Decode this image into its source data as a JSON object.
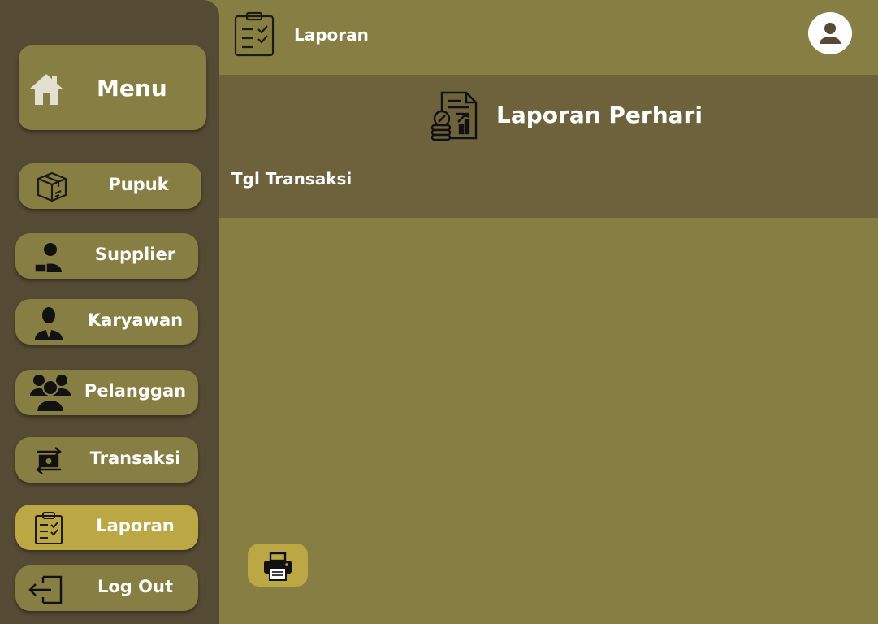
{
  "sidebar": {
    "menu_label": "Menu",
    "items": [
      {
        "label": "Pupuk",
        "icon": "box-icon"
      },
      {
        "label": "Supplier",
        "icon": "supplier-icon"
      },
      {
        "label": "Karyawan",
        "icon": "employee-icon"
      },
      {
        "label": "Pelanggan",
        "icon": "customers-icon"
      },
      {
        "label": "Transaksi",
        "icon": "transaction-icon"
      },
      {
        "label": "Laporan",
        "icon": "clipboard-icon",
        "active": true
      },
      {
        "label": "Log Out",
        "icon": "logout-icon"
      }
    ]
  },
  "header": {
    "title": "Laporan"
  },
  "report": {
    "title": "Laporan Perhari",
    "date_label": "Tgl Transaksi"
  },
  "colors": {
    "background": "#877e43",
    "sidebar": "#554a34",
    "panel": "#6d623c",
    "active": "#bba844",
    "text": "#ffffff"
  }
}
